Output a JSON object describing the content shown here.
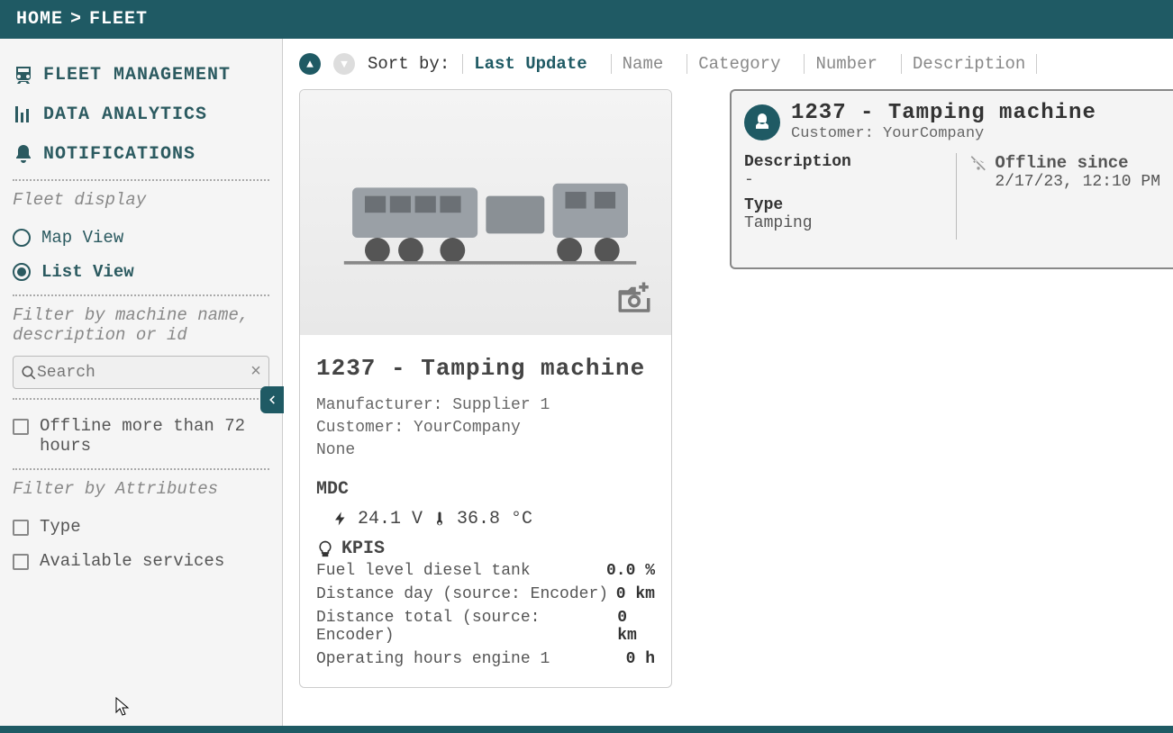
{
  "breadcrumb": {
    "home": "HOME",
    "sep": ">",
    "current": "FLEET"
  },
  "nav": {
    "fleet": "FLEET MANAGEMENT",
    "analytics": "DATA ANALYTICS",
    "notifications": "NOTIFICATIONS"
  },
  "sidebar": {
    "fleet_display_label": "Fleet display",
    "map_view": "Map View",
    "list_view": "List View",
    "filter_label": "Filter by machine name, description or id",
    "search_placeholder": "Search",
    "offline_filter": "Offline more than 72 hours",
    "filter_attr_label": "Filter by Attributes",
    "attr_type": "Type",
    "attr_services": "Available services"
  },
  "sort": {
    "label": "Sort by:",
    "options": {
      "last_update": "Last Update",
      "name": "Name",
      "category": "Category",
      "number": "Number",
      "description": "Description"
    }
  },
  "card": {
    "title": "1237 - Tamping machine",
    "manufacturer_line": "Manufacturer: Supplier 1",
    "customer_line": "Customer: YourCompany",
    "extra_line": "None",
    "mdc_label": "MDC",
    "voltage": "24.1 V",
    "temperature": "36.8 °C",
    "kpis_label": "KPIS",
    "kpis": [
      {
        "label": "Fuel level diesel tank",
        "value": "0.0 %"
      },
      {
        "label": "Distance day (source: Encoder)",
        "value": "0 km"
      },
      {
        "label": "Distance total (source: Encoder)",
        "value": "0 km"
      },
      {
        "label": "Operating hours engine 1",
        "value": "0 h"
      }
    ]
  },
  "detail": {
    "title": "1237 - Tamping machine",
    "customer_line": "Customer: YourCompany",
    "desc_label": "Description",
    "desc_value": "-",
    "type_label": "Type",
    "type_value": "Tamping",
    "offline_label": "Offline since",
    "offline_value": "2/17/23, 12:10 PM"
  }
}
